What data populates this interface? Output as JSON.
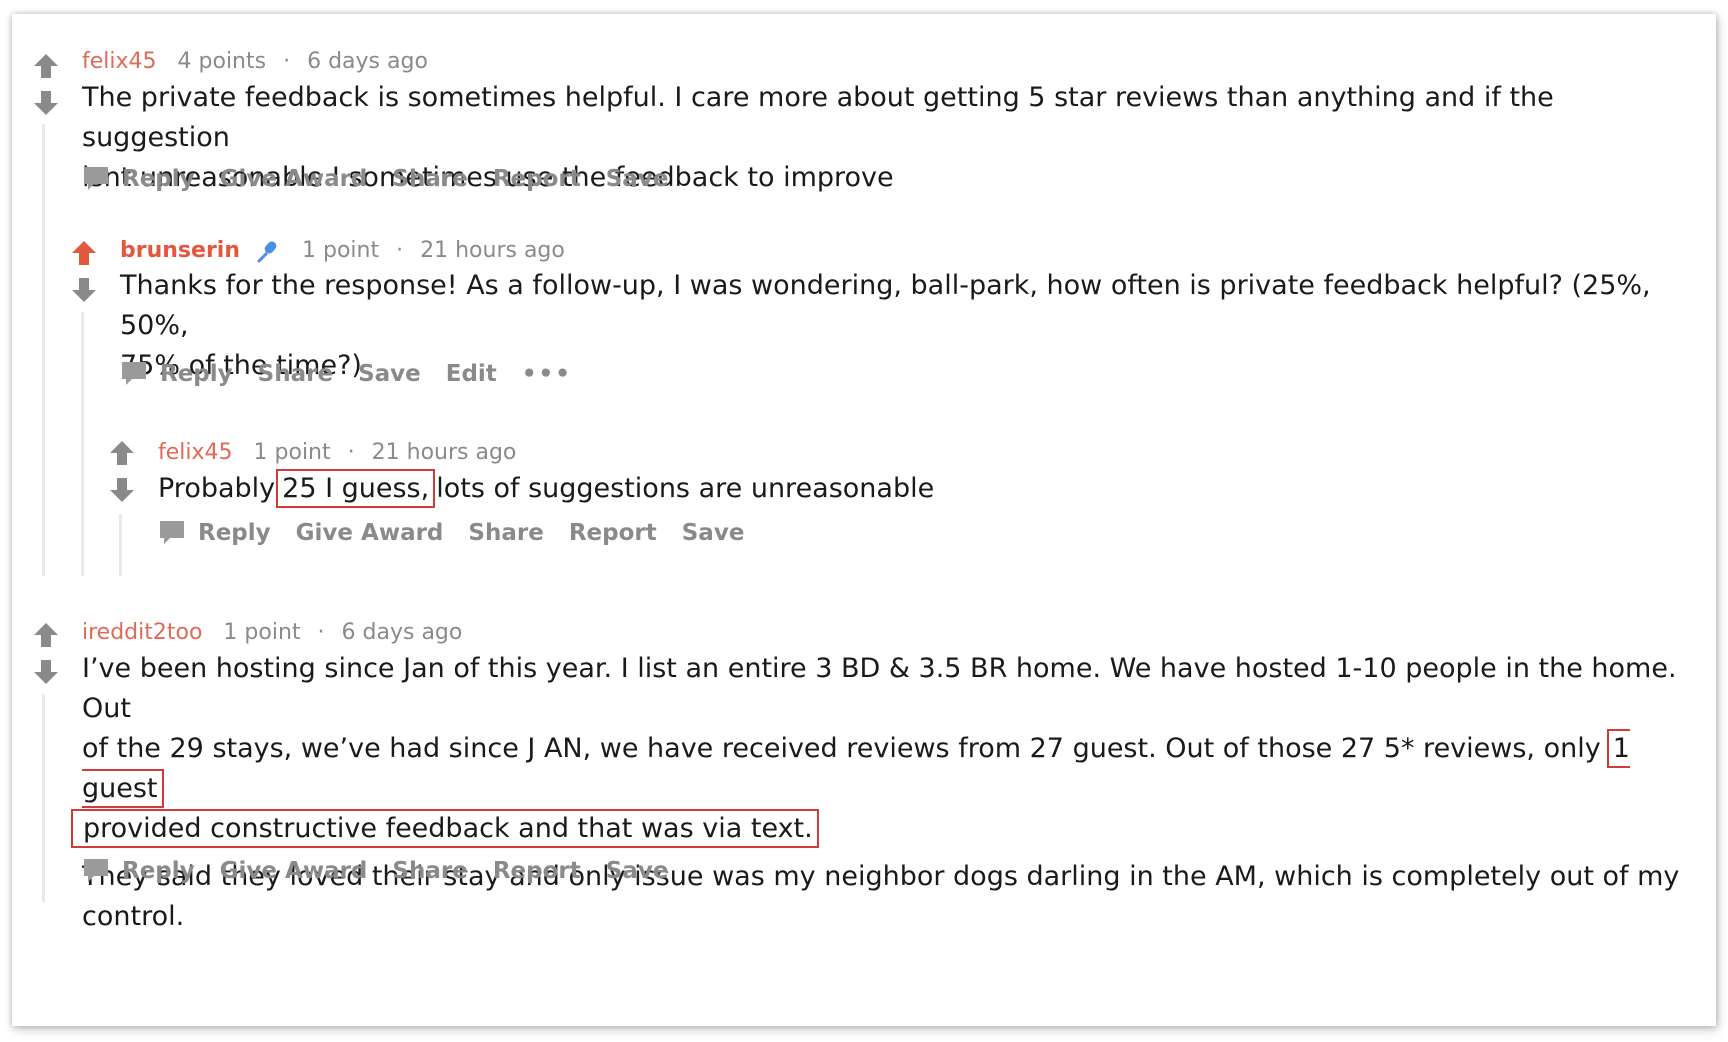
{
  "comments": [
    {
      "author": "felix45",
      "score": "4 points",
      "separator": "·",
      "time": "6 days ago",
      "body_lines": [
        "The private feedback is sometimes helpful. I care more about getting 5 star reviews than anything and if the suggestion",
        "isnt unreasonable I sometimes use the feedback to improve"
      ],
      "actions": [
        "Reply",
        "Give Award",
        "Share",
        "Report",
        "Save"
      ]
    },
    {
      "author": "brunserin",
      "score": "1 point",
      "separator": "·",
      "time": "21 hours ago",
      "body_lines": [
        "Thanks for the response! As a follow-up, I was wondering, ball-park, how often is private feedback helpful? (25%, 50%,",
        "75% of the time?)"
      ],
      "actions": [
        "Reply",
        "Share",
        "Save",
        "Edit",
        "•••"
      ]
    },
    {
      "author": "felix45",
      "score": "1 point",
      "separator": "·",
      "time": "21 hours ago",
      "body_prefix": "Probably",
      "body_highlight": "25 I guess,",
      "body_suffix": "lots of suggestions are unreasonable",
      "actions": [
        "Reply",
        "Give Award",
        "Share",
        "Report",
        "Save"
      ]
    },
    {
      "author": "ireddit2too",
      "score": "1 point",
      "separator": "·",
      "time": "6 days ago",
      "line1": "I’ve been hosting since Jan of this year. I list an entire 3 BD & 3.5 BR home. We have hosted 1-10 people in the home. Out",
      "line2_prefix": "of the 29 stays, we’ve had since J AN, we have received reviews from 27 guest. Out of those 27 5* reviews, only",
      "line2_highlight": "1 guest",
      "line3_highlight": "provided constructive feedback and that was via text.",
      "paragraph2_lines": [
        "They said they loved their stay and only issue was my neighbor dogs darling in the AM, which is completely out of my",
        "control."
      ],
      "actions": [
        "Reply",
        "Give Award",
        "Share",
        "Report",
        "Save"
      ]
    }
  ],
  "colors": {
    "username": "#e06a5a",
    "op_username": "#e2583e",
    "upvoted_arrow": "#e2583e",
    "arrow_gray": "#8a8a8a",
    "highlight_box": "#d23a3a",
    "text": "#1a1a1b",
    "meta": "#8a8a8a"
  },
  "icons": {
    "upvote": "up-arrow-icon",
    "downvote": "down-arrow-icon",
    "reply": "chat-bubble-icon",
    "flair": "microphone-icon"
  }
}
